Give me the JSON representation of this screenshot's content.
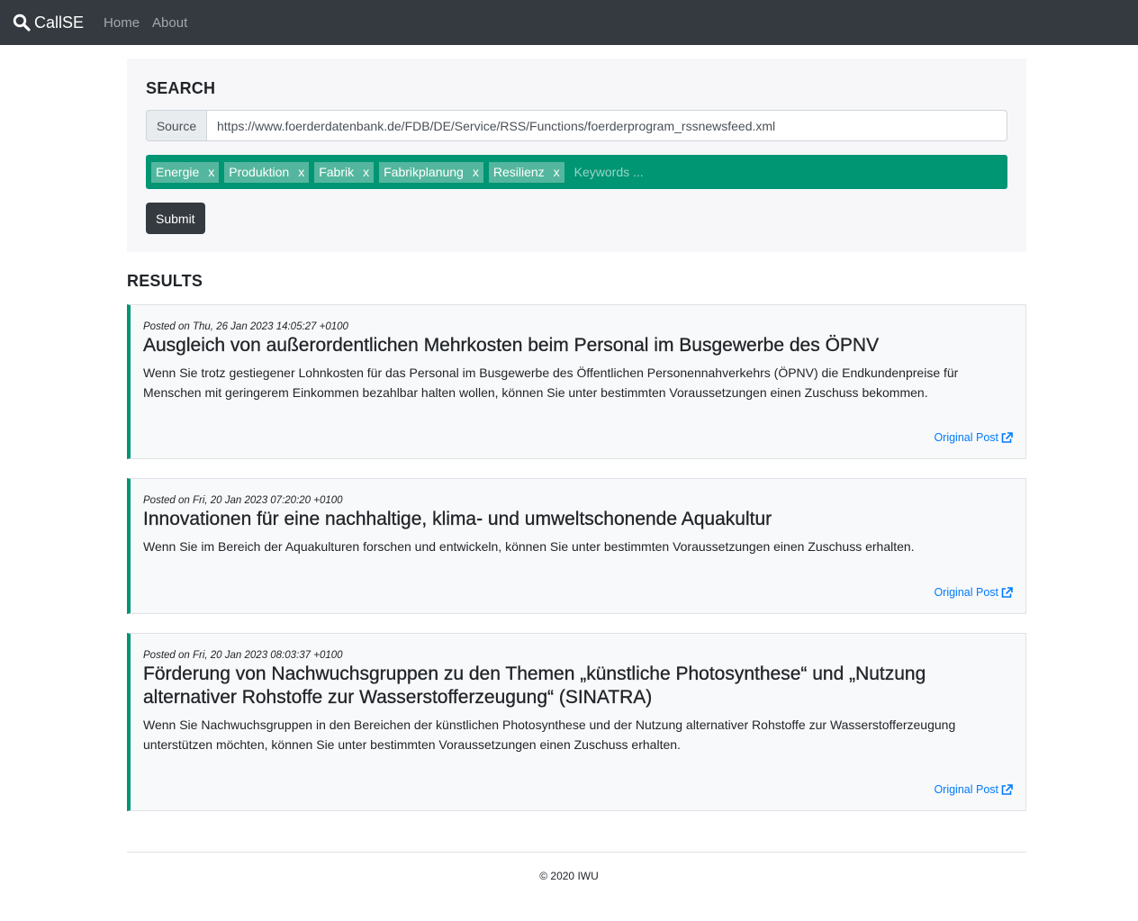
{
  "nav": {
    "brand": "CallSE",
    "links": [
      "Home",
      "About"
    ]
  },
  "search": {
    "title": "SEARCH",
    "source_label": "Source",
    "source_value": "https://www.foerderdatenbank.de/FDB/DE/Service/RSS/Functions/foerderprogram_rssnewsfeed.xml",
    "tags": [
      "Energie",
      "Produktion",
      "Fabrik",
      "Fabrikplanung",
      "Resilienz"
    ],
    "tag_remove": "x",
    "keywords_placeholder": "Keywords ...",
    "submit_label": "Submit"
  },
  "results": {
    "title": "RESULTS",
    "items": [
      {
        "meta": "Posted on Thu, 26 Jan 2023 14:05:27 +0100",
        "title": "Ausgleich von außerordentlichen Mehrkosten beim Personal im Busgewerbe des ÖPNV",
        "text": "Wenn Sie trotz gestiegener Lohnkosten für das Personal im Busgewerbe des Öffentlichen Personennahverkehrs (ÖPNV) die Endkundenpreise für Menschen mit geringerem Einkommen bezahlbar halten wollen, können Sie unter bestimmten Voraussetzungen einen Zuschuss bekommen.",
        "link": "Original Post"
      },
      {
        "meta": "Posted on Fri, 20 Jan 2023 07:20:20 +0100",
        "title": "Innovationen für eine nachhaltige, klima- und umweltschonende Aquakultur",
        "text": "Wenn Sie im Bereich der Aquakulturen forschen und entwickeln, können Sie unter bestimmten Voraussetzungen einen Zuschuss erhalten.",
        "link": "Original Post"
      },
      {
        "meta": "Posted on Fri, 20 Jan 2023 08:03:37 +0100",
        "title": "Förderung von Nachwuchsgruppen zu den Themen „künstliche Photosynthese“ und „Nutzung alternativer Rohstoffe zur Wasserstofferzeugung“ (SINATRA)",
        "text": "Wenn Sie Nachwuchsgruppen in den Bereichen der künstlichen Photosynthese und der Nutzung alternativer Rohstoffe zur Wasserstofferzeugung unterstützen möchten, können Sie unter bestimmten Voraussetzungen einen Zuschuss erhalten.",
        "link": "Original Post"
      }
    ]
  },
  "footer": {
    "text": "© 2020 IWU"
  },
  "colors": {
    "navbar": "#343a40",
    "accent": "#009573",
    "tag": "#54b69e",
    "link": "#007bff"
  },
  "icons": {
    "brand": "search-icon",
    "external": "external-link-icon"
  }
}
